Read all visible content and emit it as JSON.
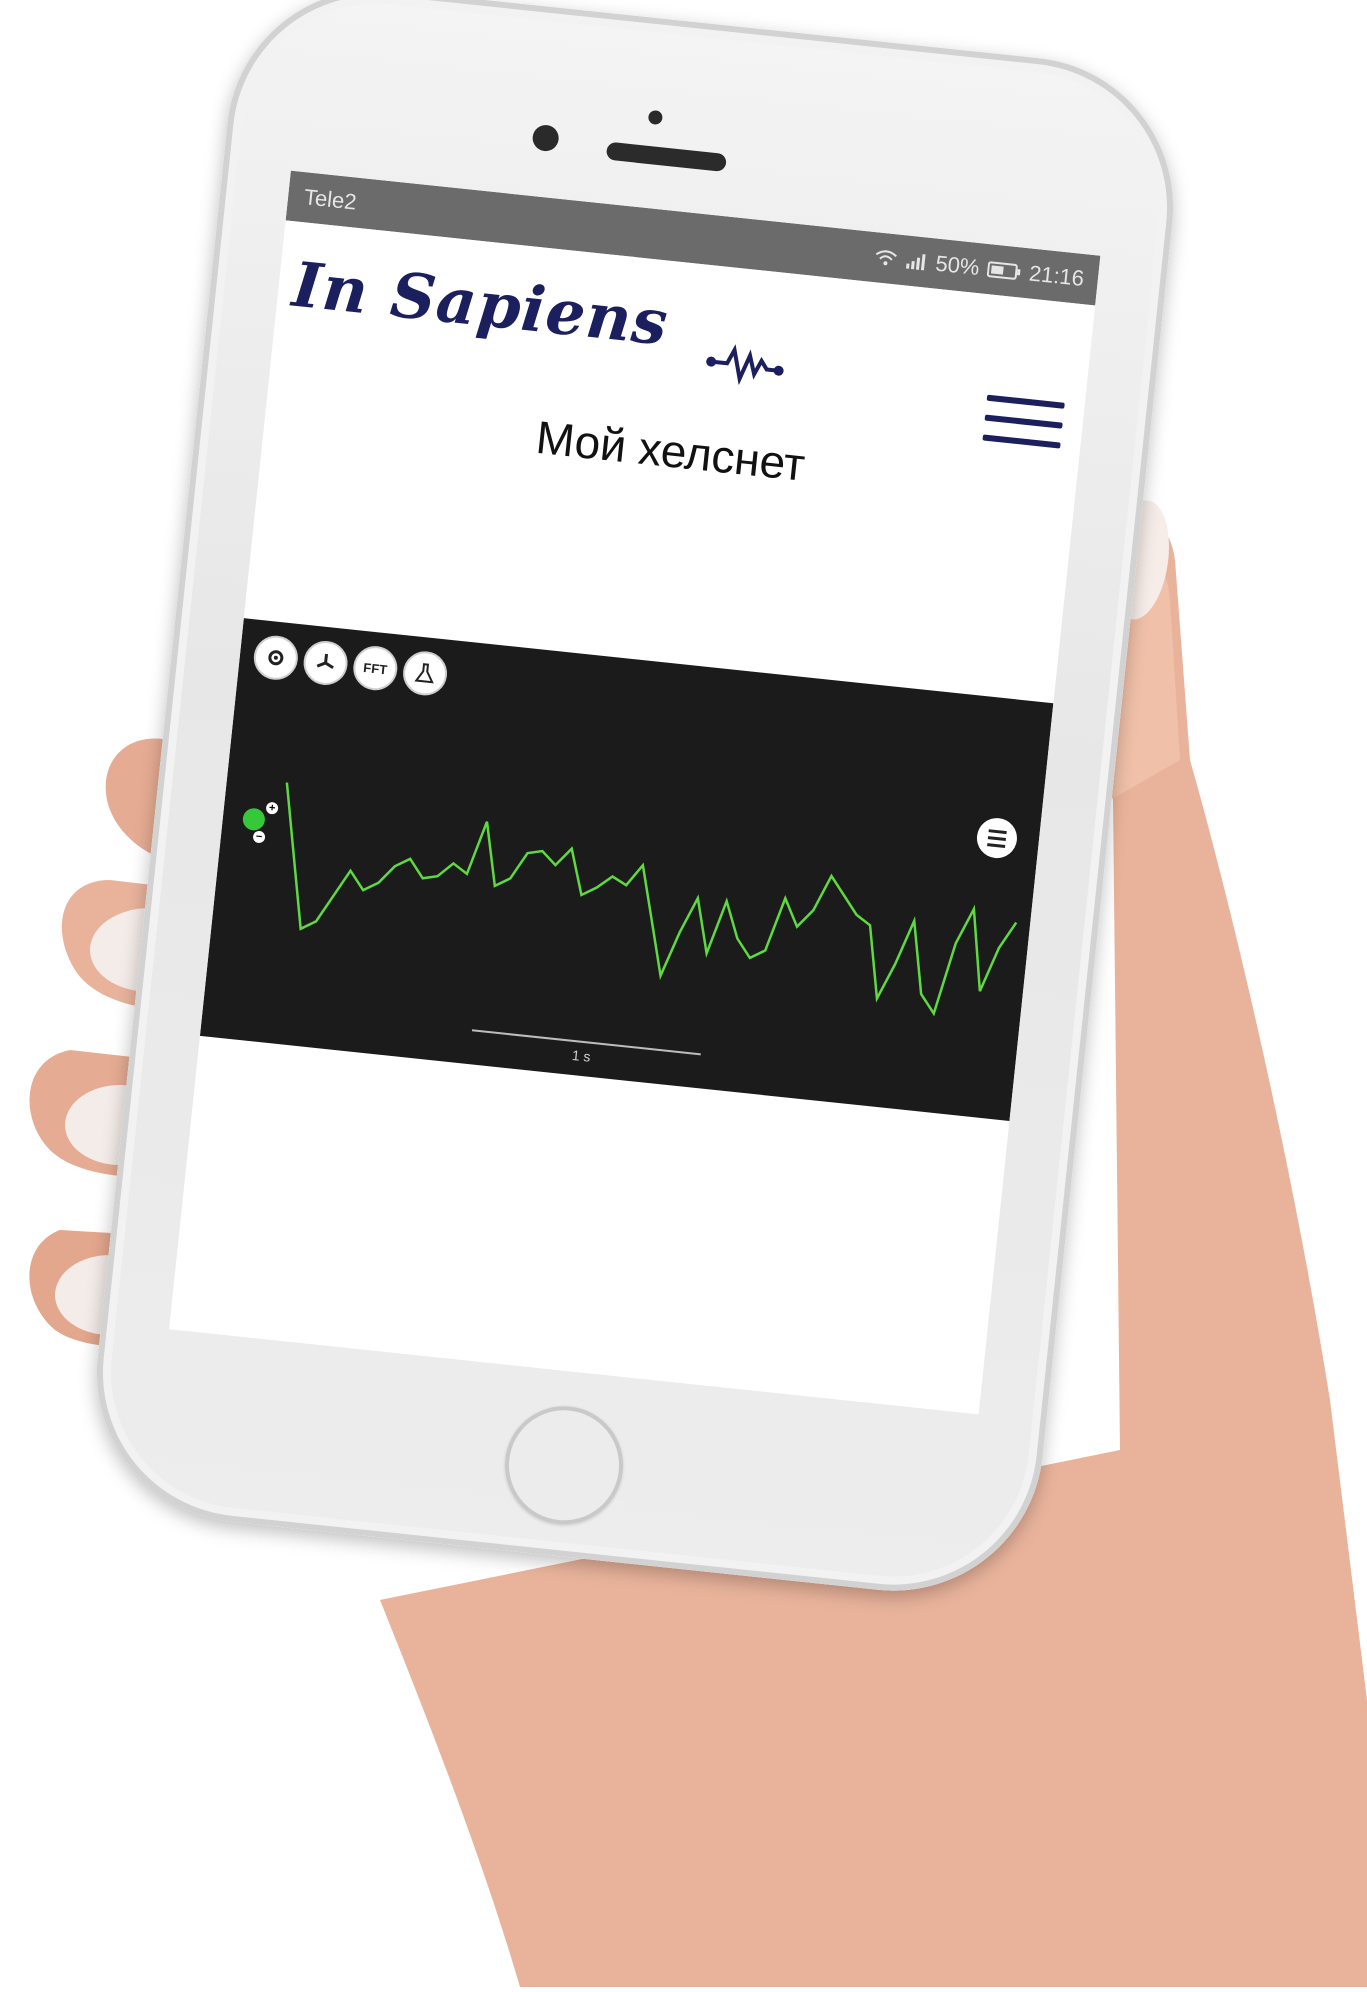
{
  "status_bar": {
    "carrier": "Tele2",
    "battery": "50%",
    "time": "21:16"
  },
  "app": {
    "logo": "In Sapiens",
    "page_title": "Мой хелснет"
  },
  "toolbar": {
    "fft_label": "FFT",
    "icons": [
      "gear-icon",
      "fan-icon",
      "fft-icon",
      "flask-icon"
    ]
  },
  "chart_data": {
    "type": "line",
    "title": "",
    "xlabel": "",
    "ylabel": "",
    "scale_label": "1 s",
    "series": [
      {
        "color": "#5fd93f",
        "values": [
          0.95,
          0.55,
          0.15,
          0.2,
          0.35,
          0.5,
          0.4,
          0.45,
          0.55,
          0.6,
          0.5,
          0.52,
          0.6,
          0.55,
          0.85,
          0.5,
          0.55,
          0.7,
          0.72,
          0.65,
          0.75,
          0.5,
          0.55,
          0.62,
          0.58,
          0.7,
          0.4,
          0.1,
          0.35,
          0.55,
          0.25,
          0.55,
          0.35,
          0.25,
          0.3,
          0.6,
          0.45,
          0.55,
          0.75,
          0.65,
          0.55,
          0.5,
          0.1,
          0.3,
          0.55,
          0.15,
          0.05,
          0.45,
          0.65,
          0.2,
          0.45,
          0.6
        ]
      }
    ]
  },
  "colors": {
    "brand": "#1c1f5e",
    "chart_bg": "#1b1b1b",
    "trace": "#5fd93f",
    "channel_dot": "#35c93a"
  }
}
